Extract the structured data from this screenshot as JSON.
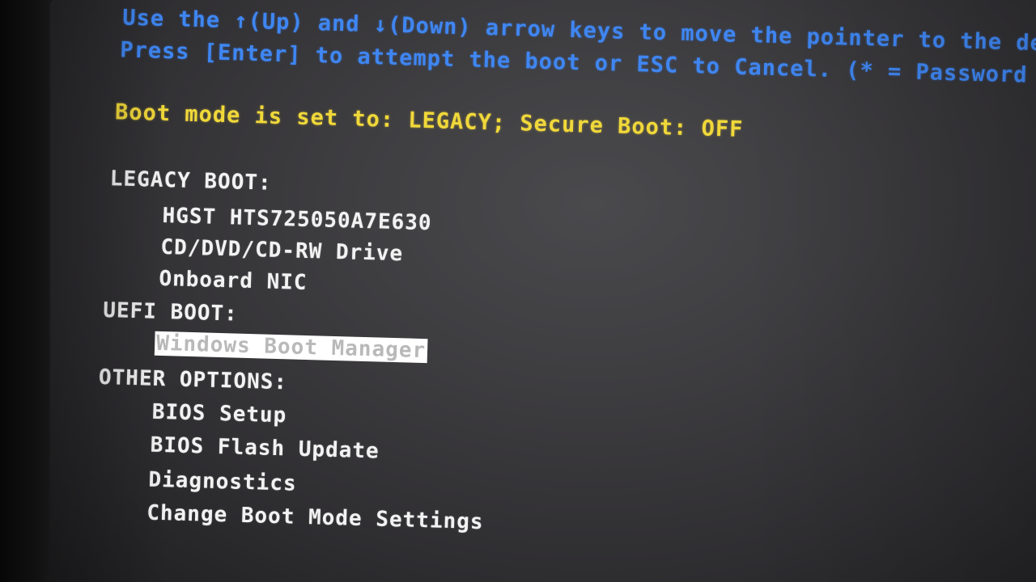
{
  "instructions": {
    "line1": "Use the ↑(Up) and ↓(Down) arrow keys to move the pointer to the desired boot",
    "line2": "Press [Enter] to attempt the boot or ESC to Cancel. (* = Password Required)"
  },
  "status": {
    "boot_mode": "Boot mode is set to: LEGACY; Secure Boot: OFF"
  },
  "legacy_boot": {
    "header": "LEGACY BOOT:",
    "items": [
      "HGST HTS725050A7E630",
      "CD/DVD/CD-RW Drive",
      "Onboard NIC"
    ]
  },
  "uefi_boot": {
    "header": "UEFI BOOT:",
    "items": [
      "Windows Boot Manager"
    ],
    "selected_index": 0
  },
  "other_options": {
    "header": "OTHER OPTIONS:",
    "items": [
      "BIOS Setup",
      "BIOS Flash Update",
      "Diagnostics",
      "Change Boot Mode Settings"
    ]
  },
  "colors": {
    "instruction_text": "#3f86f2",
    "status_text": "#f0d83a",
    "menu_text": "#f2f2f2",
    "selection_background": "#ffffff"
  }
}
